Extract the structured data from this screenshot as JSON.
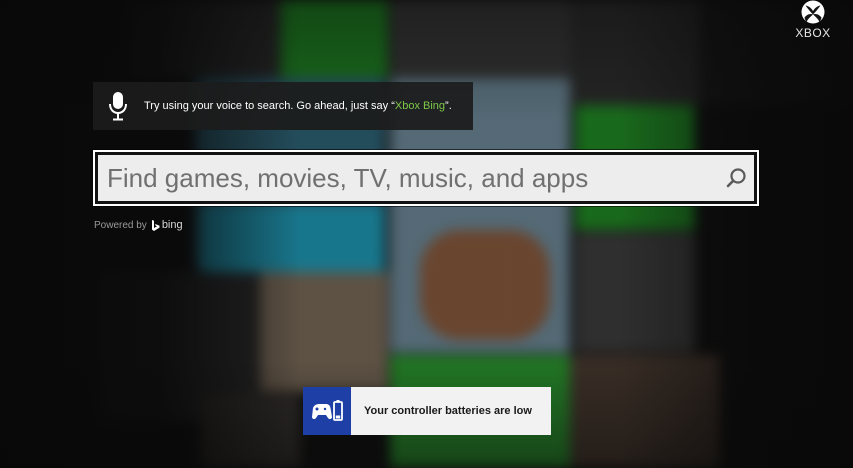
{
  "brand": {
    "wordmark": "XBOX",
    "logo_icon": "xbox-sphere-icon",
    "accent_color": "#107c10"
  },
  "voice_tip": {
    "icon": "microphone-icon",
    "text_prefix": "Try using your voice to search. Go ahead, just say “",
    "highlight": "Xbox Bing",
    "text_suffix": "”.",
    "highlight_color": "#7ec94a"
  },
  "search": {
    "placeholder": "Find games, movies, TV, music, and apps",
    "value": "",
    "button_icon": "search-icon"
  },
  "powered_by": {
    "label": "Powered by",
    "brand": "bing",
    "icon": "bing-logo-icon"
  },
  "notification": {
    "icon": "controller-battery-low-icon",
    "text": "Your controller batteries are low",
    "icon_bg": "#1e40a6"
  }
}
